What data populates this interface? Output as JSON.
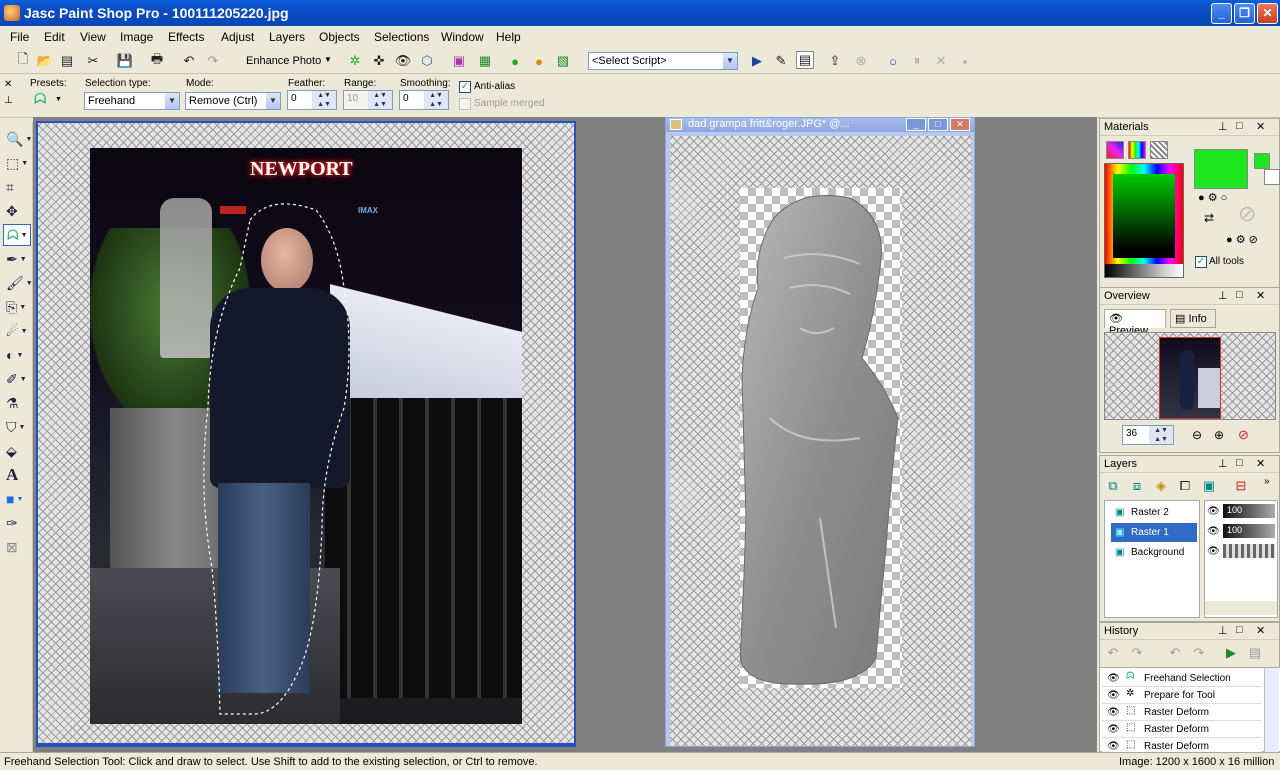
{
  "window": {
    "title": "Jasc Paint Shop Pro - 100111205220.jpg",
    "minimize": "_",
    "maximize": "❐",
    "close": "✕"
  },
  "menu": [
    "File",
    "Edit",
    "View",
    "Image",
    "Effects",
    "Adjust",
    "Layers",
    "Objects",
    "Selections",
    "Window",
    "Help"
  ],
  "toolbar": {
    "enhance_photo": "Enhance Photo",
    "script_select": "<Select Script>"
  },
  "tool_options": {
    "presets_label": "Presets:",
    "selection_type_label": "Selection type:",
    "selection_type_value": "Freehand",
    "mode_label": "Mode:",
    "mode_value": "Remove (Ctrl)",
    "feather_label": "Feather:",
    "feather_value": "0",
    "range_label": "Range:",
    "range_value": "10",
    "smoothing_label": "Smoothing:",
    "smoothing_value": "0",
    "antialias_label": "Anti-alias",
    "sample_merged_label": "Sample merged"
  },
  "doc1": {
    "sign_text": "NEWPORT",
    "imax_text": "IMAX"
  },
  "doc2": {
    "title": "dad.grampa fritt&roger.JPG* @..."
  },
  "materials": {
    "title": "Materials",
    "all_tools": "All tools",
    "fg_color": "#1ee61e"
  },
  "overview": {
    "title": "Overview",
    "tab_preview": "Preview",
    "tab_info": "Info",
    "zoom": "36"
  },
  "layers": {
    "title": "Layers",
    "items": [
      {
        "name": "Raster 2",
        "opacity": "100"
      },
      {
        "name": "Raster 1",
        "opacity": "100"
      },
      {
        "name": "Background",
        "opacity": ""
      }
    ]
  },
  "history": {
    "title": "History",
    "items": [
      "Freehand Selection",
      "Prepare for Tool",
      "Raster Deform",
      "Raster Deform",
      "Raster Deform"
    ]
  },
  "status": {
    "message": "Freehand Selection Tool: Click and draw to select. Use Shift to add to the existing selection, or Ctrl to remove.",
    "image_info": "Image:  1200 x 1600 x 16 million"
  }
}
